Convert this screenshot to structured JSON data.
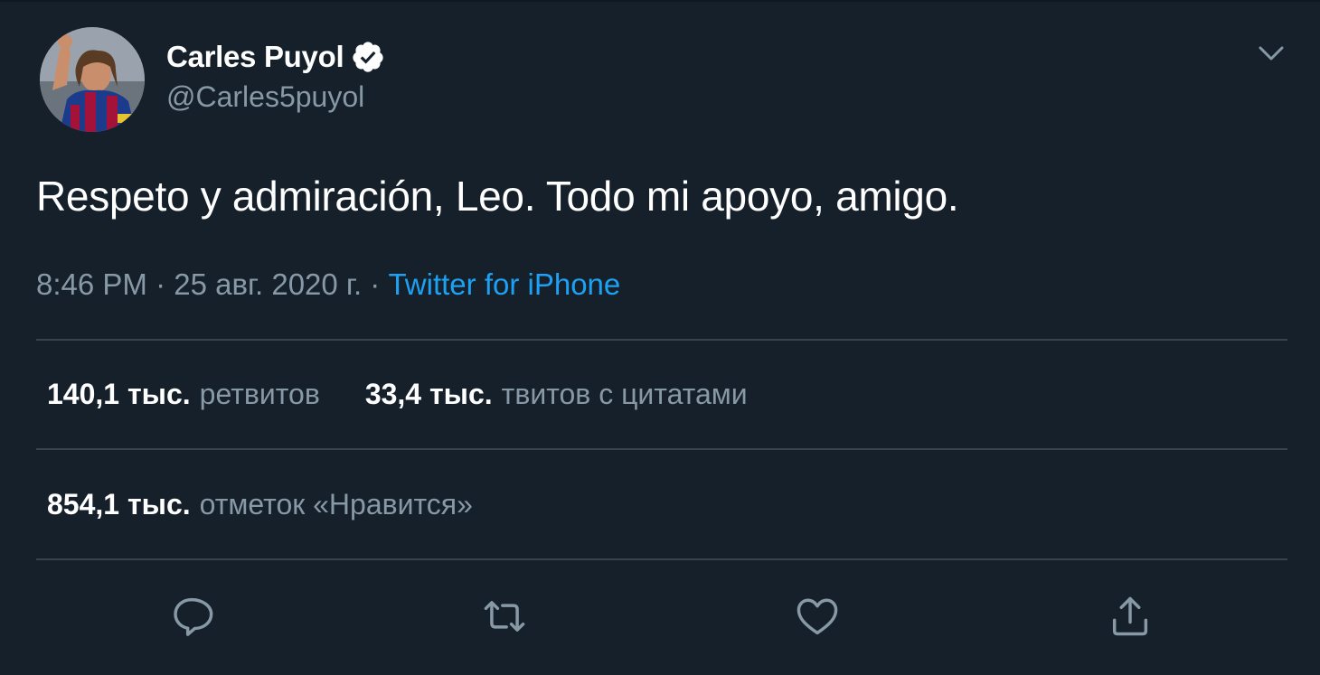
{
  "user": {
    "display_name": "Carles Puyol",
    "handle": "@Carles5puyol",
    "verified": true
  },
  "tweet": {
    "text": "Respeto y admiración, Leo. Todo mi apoyo, amigo.",
    "time": "8:46 PM",
    "date": "25 авг. 2020 г.",
    "separator": "·",
    "source": "Twitter for iPhone"
  },
  "stats": {
    "retweets": {
      "count": "140,1 тыс.",
      "label": "ретвитов"
    },
    "quotes": {
      "count": "33,4 тыс.",
      "label": "твитов с цитатами"
    },
    "likes": {
      "count": "854,1 тыс.",
      "label": "отметок «Нравится»"
    }
  },
  "actions": [
    {
      "icon": "reply-icon"
    },
    {
      "icon": "retweet-icon"
    },
    {
      "icon": "like-icon"
    },
    {
      "icon": "share-icon"
    }
  ],
  "colors": {
    "background": "#15202b",
    "primary_text": "#ffffff",
    "secondary_text": "#8899a6",
    "link": "#1da1f2",
    "divider": "#38444d"
  }
}
